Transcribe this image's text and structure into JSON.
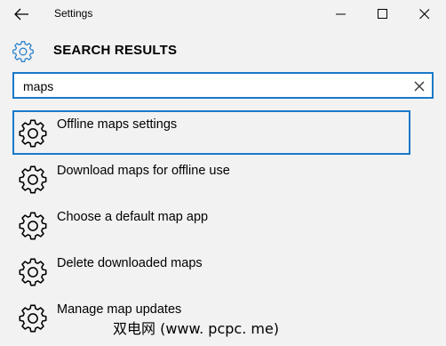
{
  "window": {
    "title": "Settings"
  },
  "header": {
    "title": "SEARCH RESULTS"
  },
  "search": {
    "value": "maps"
  },
  "results": [
    {
      "label": "Offline maps settings",
      "selected": true
    },
    {
      "label": "Download maps for offline use",
      "selected": false
    },
    {
      "label": "Choose a default map app",
      "selected": false
    },
    {
      "label": "Delete downloaded maps",
      "selected": false
    },
    {
      "label": "Manage map updates",
      "selected": false
    }
  ],
  "watermark": "双电网 (www. pcpc. me)",
  "colors": {
    "accent": "#1979ca",
    "background": "#f2f2f2"
  },
  "icons": {
    "back": "back-arrow-icon",
    "header": "gear-icon",
    "result": "gear-icon",
    "clear": "close-icon"
  }
}
